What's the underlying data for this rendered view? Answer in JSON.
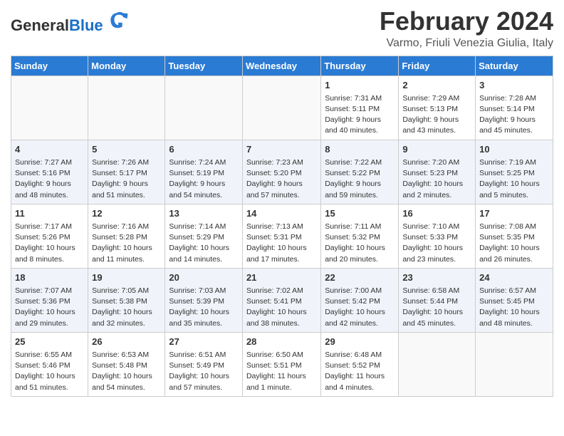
{
  "header": {
    "logo_general": "General",
    "logo_blue": "Blue",
    "month_title": "February 2024",
    "location": "Varmo, Friuli Venezia Giulia, Italy"
  },
  "days_of_week": [
    "Sunday",
    "Monday",
    "Tuesday",
    "Wednesday",
    "Thursday",
    "Friday",
    "Saturday"
  ],
  "weeks": [
    [
      {
        "day": "",
        "info": ""
      },
      {
        "day": "",
        "info": ""
      },
      {
        "day": "",
        "info": ""
      },
      {
        "day": "",
        "info": ""
      },
      {
        "day": "1",
        "info": "Sunrise: 7:31 AM\nSunset: 5:11 PM\nDaylight: 9 hours\nand 40 minutes."
      },
      {
        "day": "2",
        "info": "Sunrise: 7:29 AM\nSunset: 5:13 PM\nDaylight: 9 hours\nand 43 minutes."
      },
      {
        "day": "3",
        "info": "Sunrise: 7:28 AM\nSunset: 5:14 PM\nDaylight: 9 hours\nand 45 minutes."
      }
    ],
    [
      {
        "day": "4",
        "info": "Sunrise: 7:27 AM\nSunset: 5:16 PM\nDaylight: 9 hours\nand 48 minutes."
      },
      {
        "day": "5",
        "info": "Sunrise: 7:26 AM\nSunset: 5:17 PM\nDaylight: 9 hours\nand 51 minutes."
      },
      {
        "day": "6",
        "info": "Sunrise: 7:24 AM\nSunset: 5:19 PM\nDaylight: 9 hours\nand 54 minutes."
      },
      {
        "day": "7",
        "info": "Sunrise: 7:23 AM\nSunset: 5:20 PM\nDaylight: 9 hours\nand 57 minutes."
      },
      {
        "day": "8",
        "info": "Sunrise: 7:22 AM\nSunset: 5:22 PM\nDaylight: 9 hours\nand 59 minutes."
      },
      {
        "day": "9",
        "info": "Sunrise: 7:20 AM\nSunset: 5:23 PM\nDaylight: 10 hours\nand 2 minutes."
      },
      {
        "day": "10",
        "info": "Sunrise: 7:19 AM\nSunset: 5:25 PM\nDaylight: 10 hours\nand 5 minutes."
      }
    ],
    [
      {
        "day": "11",
        "info": "Sunrise: 7:17 AM\nSunset: 5:26 PM\nDaylight: 10 hours\nand 8 minutes."
      },
      {
        "day": "12",
        "info": "Sunrise: 7:16 AM\nSunset: 5:28 PM\nDaylight: 10 hours\nand 11 minutes."
      },
      {
        "day": "13",
        "info": "Sunrise: 7:14 AM\nSunset: 5:29 PM\nDaylight: 10 hours\nand 14 minutes."
      },
      {
        "day": "14",
        "info": "Sunrise: 7:13 AM\nSunset: 5:31 PM\nDaylight: 10 hours\nand 17 minutes."
      },
      {
        "day": "15",
        "info": "Sunrise: 7:11 AM\nSunset: 5:32 PM\nDaylight: 10 hours\nand 20 minutes."
      },
      {
        "day": "16",
        "info": "Sunrise: 7:10 AM\nSunset: 5:33 PM\nDaylight: 10 hours\nand 23 minutes."
      },
      {
        "day": "17",
        "info": "Sunrise: 7:08 AM\nSunset: 5:35 PM\nDaylight: 10 hours\nand 26 minutes."
      }
    ],
    [
      {
        "day": "18",
        "info": "Sunrise: 7:07 AM\nSunset: 5:36 PM\nDaylight: 10 hours\nand 29 minutes."
      },
      {
        "day": "19",
        "info": "Sunrise: 7:05 AM\nSunset: 5:38 PM\nDaylight: 10 hours\nand 32 minutes."
      },
      {
        "day": "20",
        "info": "Sunrise: 7:03 AM\nSunset: 5:39 PM\nDaylight: 10 hours\nand 35 minutes."
      },
      {
        "day": "21",
        "info": "Sunrise: 7:02 AM\nSunset: 5:41 PM\nDaylight: 10 hours\nand 38 minutes."
      },
      {
        "day": "22",
        "info": "Sunrise: 7:00 AM\nSunset: 5:42 PM\nDaylight: 10 hours\nand 42 minutes."
      },
      {
        "day": "23",
        "info": "Sunrise: 6:58 AM\nSunset: 5:44 PM\nDaylight: 10 hours\nand 45 minutes."
      },
      {
        "day": "24",
        "info": "Sunrise: 6:57 AM\nSunset: 5:45 PM\nDaylight: 10 hours\nand 48 minutes."
      }
    ],
    [
      {
        "day": "25",
        "info": "Sunrise: 6:55 AM\nSunset: 5:46 PM\nDaylight: 10 hours\nand 51 minutes."
      },
      {
        "day": "26",
        "info": "Sunrise: 6:53 AM\nSunset: 5:48 PM\nDaylight: 10 hours\nand 54 minutes."
      },
      {
        "day": "27",
        "info": "Sunrise: 6:51 AM\nSunset: 5:49 PM\nDaylight: 10 hours\nand 57 minutes."
      },
      {
        "day": "28",
        "info": "Sunrise: 6:50 AM\nSunset: 5:51 PM\nDaylight: 11 hours\nand 1 minute."
      },
      {
        "day": "29",
        "info": "Sunrise: 6:48 AM\nSunset: 5:52 PM\nDaylight: 11 hours\nand 4 minutes."
      },
      {
        "day": "",
        "info": ""
      },
      {
        "day": "",
        "info": ""
      }
    ]
  ]
}
